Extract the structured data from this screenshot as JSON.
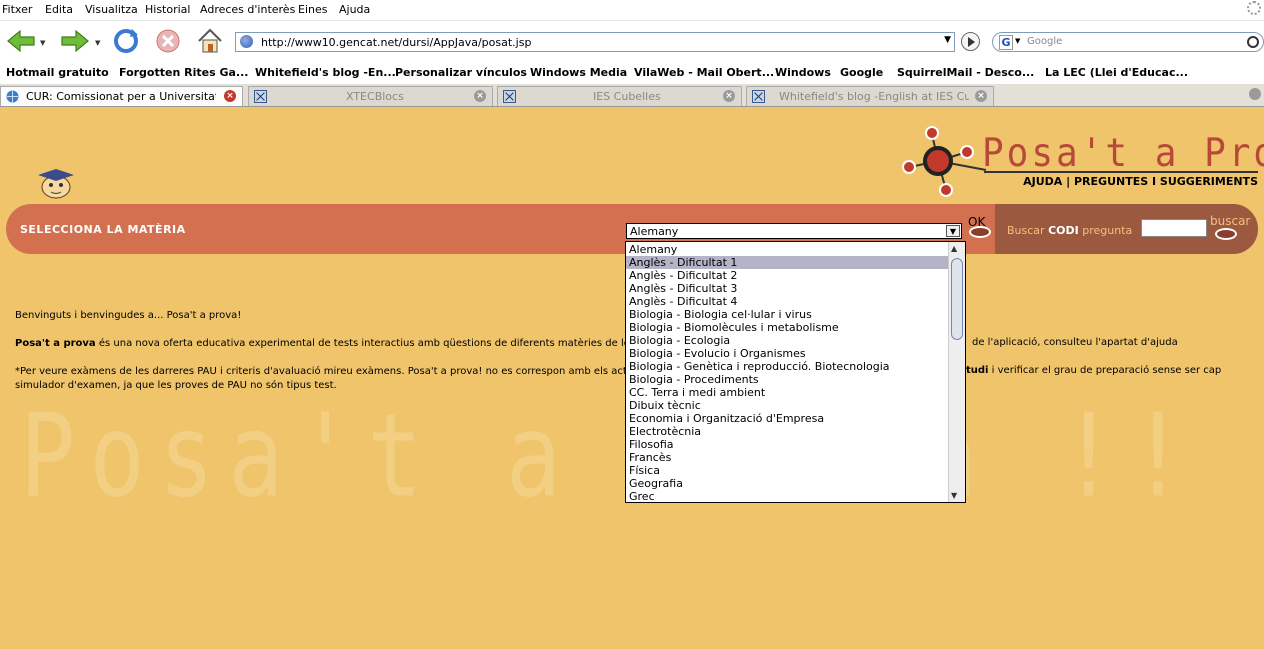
{
  "menu": [
    "Fitxer",
    "Edita",
    "Visualitza",
    "Historial",
    "Adreces d'interès",
    "Eines",
    "Ajuda"
  ],
  "toolbar": {
    "url": "http://www10.gencat.net/dursi/AppJava/posat.jsp",
    "search_placeholder": "Google",
    "search_engine_letter": "G"
  },
  "bookmarks": [
    "Hotmail gratuito",
    "Forgotten Rites Ga...",
    "Whitefield's blog -En...",
    "Personalizar vínculos",
    "Windows Media",
    "VilaWeb - Mail Obert...",
    "Windows",
    "Google",
    "SquirrelMail - Desco...",
    "La LEC (Llei d'Educac..."
  ],
  "tabs": [
    {
      "label": "CUR: Comissionat per a Universitats..."
    },
    {
      "label": "XTECBlocs"
    },
    {
      "label": "IES Cubelles"
    },
    {
      "label": "Whitefield's blog -English at IES Cub..."
    }
  ],
  "header": {
    "logo_text": "Posa't a Prova !!",
    "links": "AJUDA | PREGUNTES I SUGGERIMENTS"
  },
  "band": {
    "label": "SELECCIONA LA MATÈRIA",
    "selected": "Alemany",
    "ok": "OK",
    "buscar_prefix": "Buscar",
    "buscar_code": "CODI",
    "buscar_suffix": "pregunta",
    "buscar_button": "buscar"
  },
  "content": {
    "welcome": "Benvinguts i benvingudes a... Posa't a prova!",
    "p2_bold": "Posa't a prova",
    "p2_text": " és una nova oferta educativa experimental de tests interactius amb qüestions de diferents matèries de les PAU",
    "p2_tail": "de l'aplicació, consulteu l'apartat d'ajuda",
    "p3_line1": "*Per veure exàmens de les darreres PAU i criteris d'avaluació mireu exàmens. Posa't a prova! no es correspon amb els actuals",
    "p3_tail_bold": "tudi",
    "p3_tail": " i verificar el grau de preparació sense ser cap",
    "p3_line2": "simulador d'examen, ja que les proves de PAU no són tipus test."
  },
  "dropdown_options": [
    "Alemany",
    "Anglès - Dificultat 1",
    "Anglès - Dificultat 2",
    "Anglès - Dificultat 3",
    "Anglès - Dificultat 4",
    "Biologia - Biologia cel·lular i virus",
    "Biologia - Biomolècules i metabolisme",
    "Biologia - Ecologia",
    "Biologia - Evolucio i Organismes",
    "Biologia - Genètica i reproducció. Biotecnologia",
    "Biologia - Procediments",
    "CC. Terra i medi ambient",
    "Dibuix tècnic",
    "Economia i Organització d'Empresa",
    "Electrotècnia",
    "Filosofia",
    "Francès",
    "Física",
    "Geografia",
    "Grec"
  ],
  "highlighted_option": 1,
  "watermark": "Posa't a Prova !!     Posa't a P"
}
